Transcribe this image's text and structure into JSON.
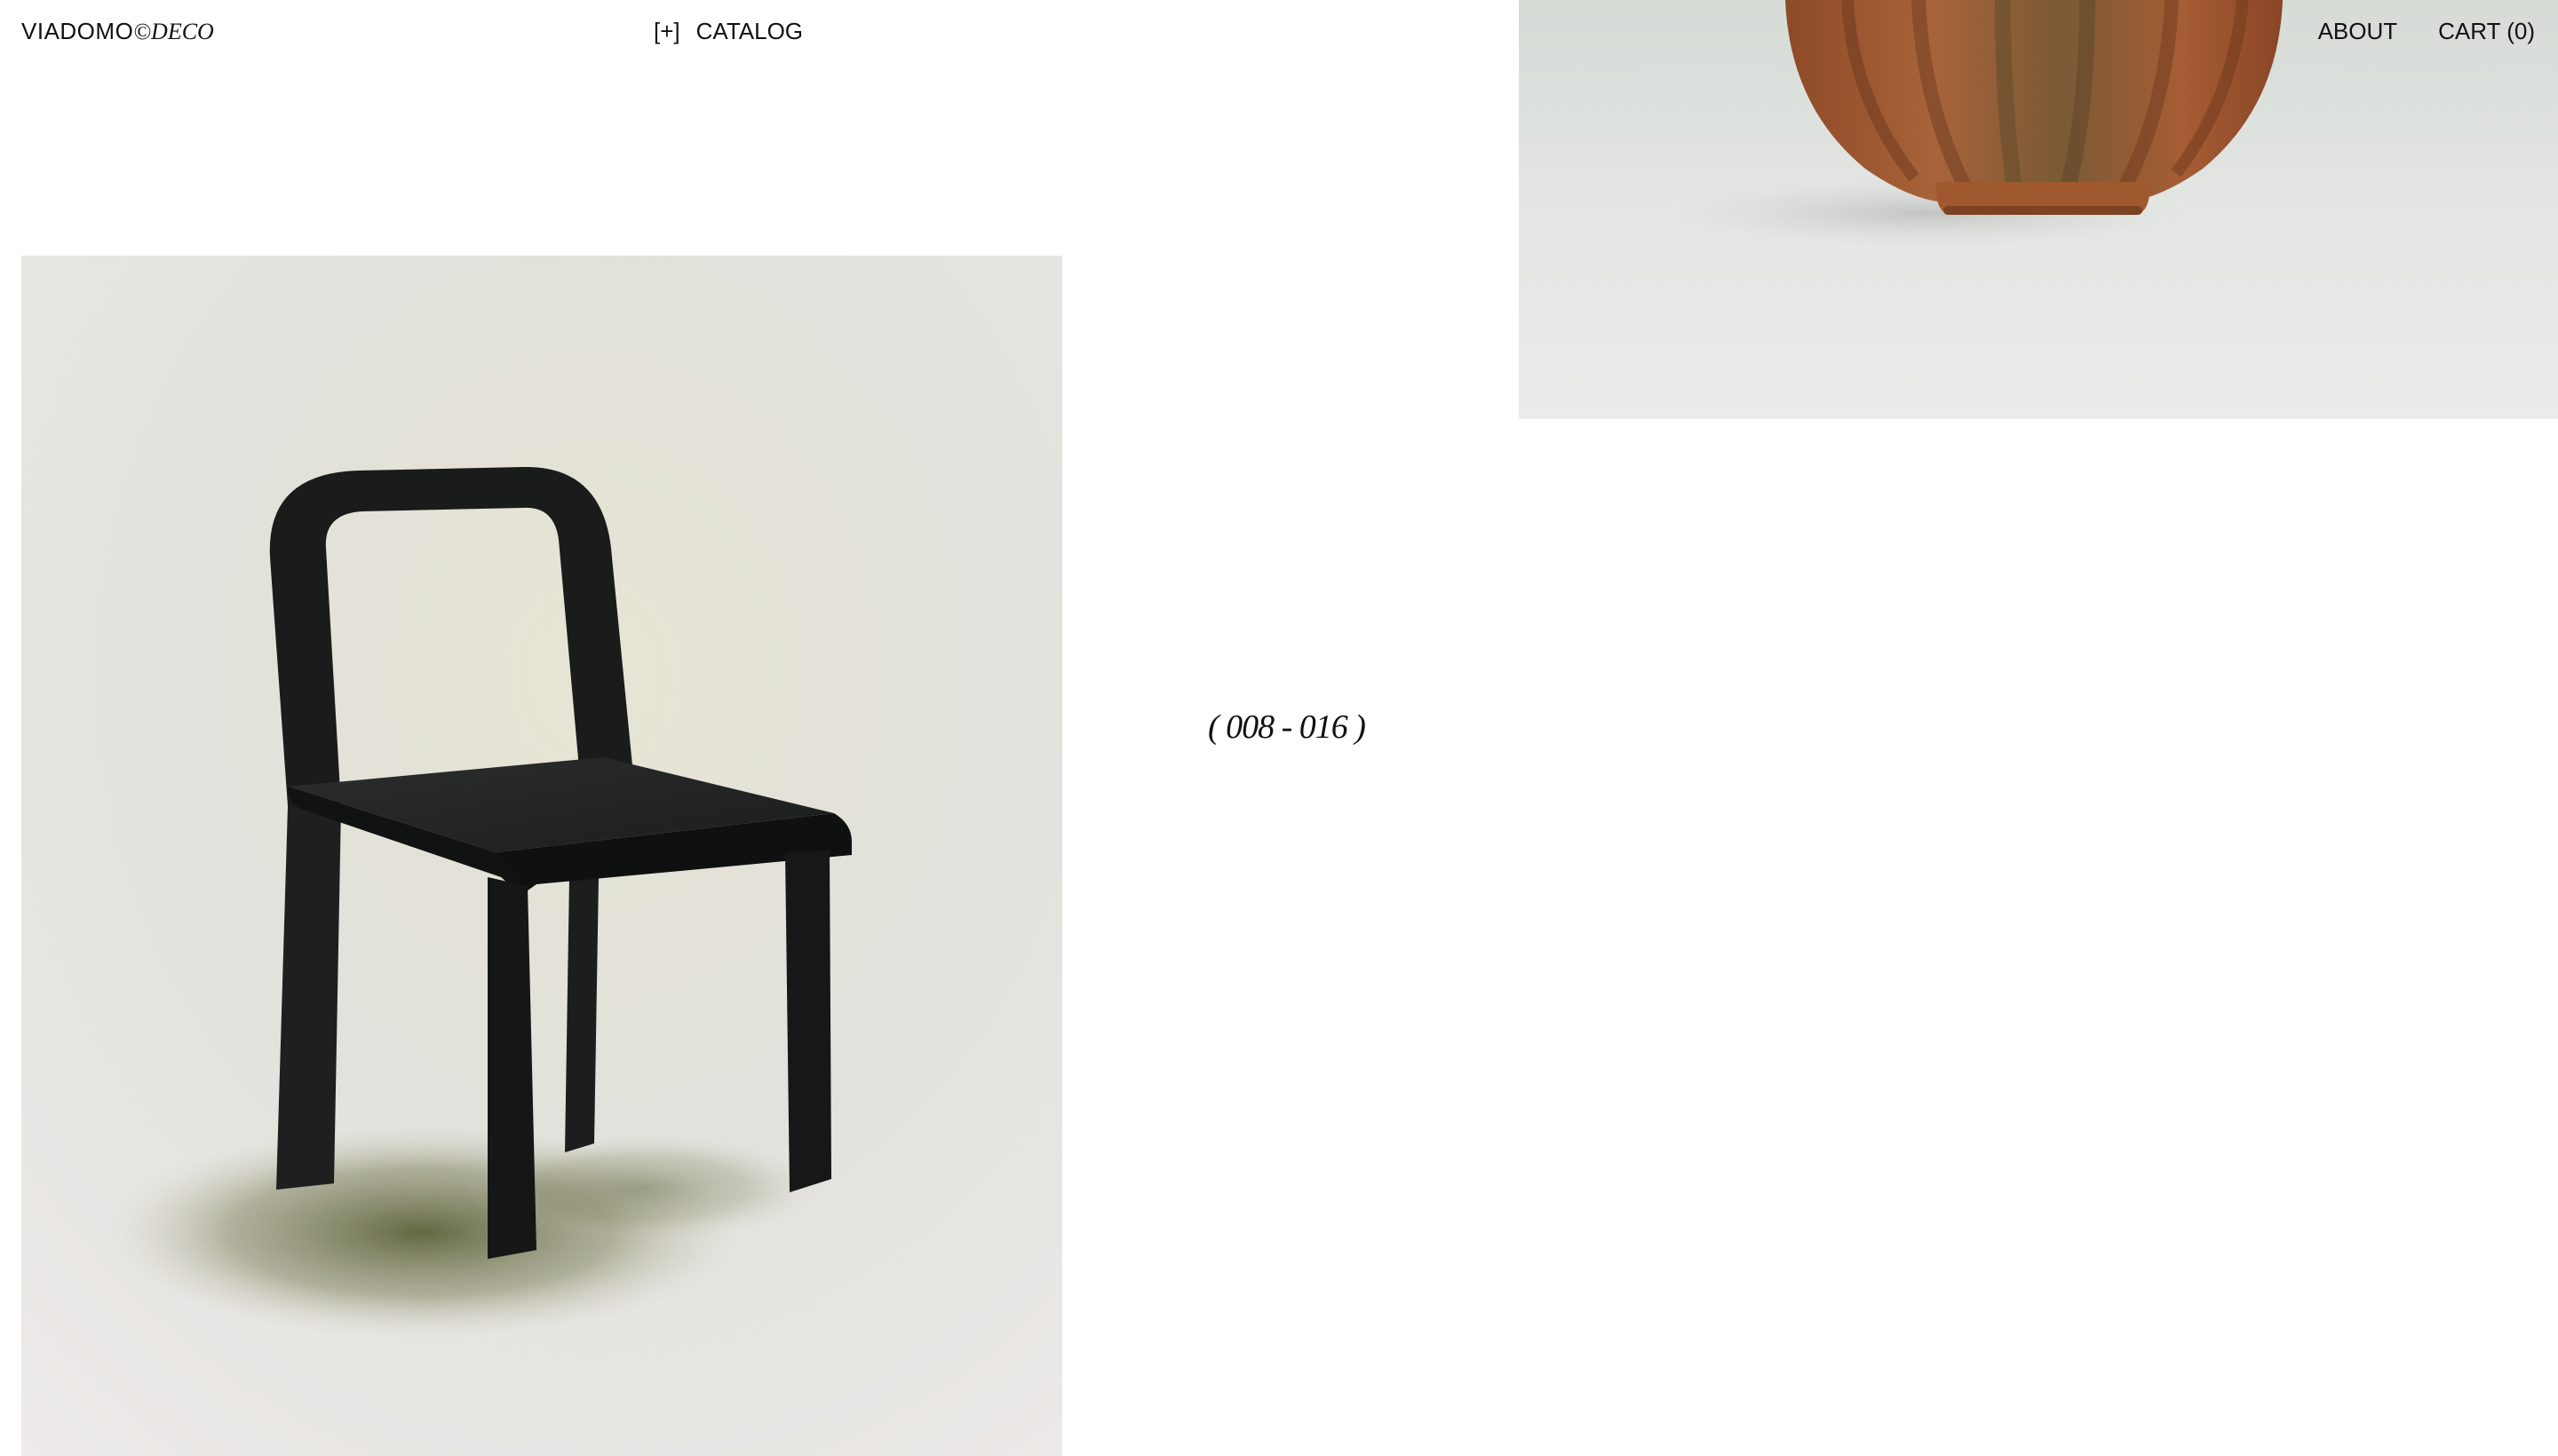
{
  "header": {
    "logo_brand": "VIADOMO",
    "logo_sub": "©DECO",
    "catalog_toggle": "[+]",
    "catalog_label": "CATALOG",
    "about_label": "ABOUT",
    "cart_label": "CART (0)"
  },
  "gallery": {
    "range_label": "( 008 - 016 )",
    "items": [
      {
        "name": "chair",
        "image": "black-chair-photo"
      },
      {
        "name": "vase",
        "image": "terracotta-vase-photo"
      }
    ]
  },
  "colors": {
    "background": "#ffffff",
    "text": "#111111",
    "vase": "#a0592f",
    "chair": "#1a1c1c"
  }
}
